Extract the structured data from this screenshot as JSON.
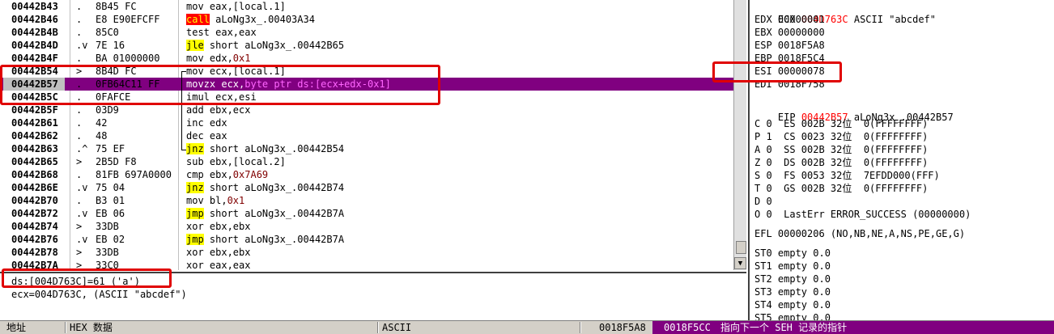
{
  "disasm": {
    "rows": [
      {
        "addr": "00442B43",
        "mark": ".",
        "hex": "8B45 FC",
        "pre": "mov eax,[local.1]",
        "kw": "",
        "post": "",
        "imm": ""
      },
      {
        "addr": "00442B46",
        "mark": ".",
        "hex": "E8 E90EFCFF",
        "pre": "",
        "kw": "call",
        "post": " aLoNg3x_.00403A34",
        "imm": ""
      },
      {
        "addr": "00442B4B",
        "mark": ".",
        "hex": "85C0",
        "pre": "test eax,eax",
        "kw": "",
        "post": "",
        "imm": ""
      },
      {
        "addr": "00442B4D",
        "mark": ".v",
        "hex": "7E 16",
        "pre": "",
        "kw": "jle",
        "post": " short aLoNg3x_.00442B65",
        "imm": ""
      },
      {
        "addr": "00442B4F",
        "mark": ".",
        "hex": "BA 01000000",
        "pre": "mov edx,",
        "kw": "",
        "post": "",
        "imm": "0x1"
      },
      {
        "addr": "00442B54",
        "mark": ">",
        "hex": "8B4D FC",
        "pre": "mov ecx,[local.1]",
        "kw": "",
        "post": "",
        "imm": ""
      },
      {
        "addr": "00442B57",
        "mark": ".",
        "hex": "0FB64C11 FF",
        "pre": "movzx ecx,",
        "kw": "",
        "post": "",
        "imm": "byte ptr ds:[ecx+edx-0x1]"
      },
      {
        "addr": "00442B5C",
        "mark": ".",
        "hex": "0FAFCE",
        "pre": "imul ecx,esi",
        "kw": "",
        "post": "",
        "imm": ""
      },
      {
        "addr": "00442B5F",
        "mark": ".",
        "hex": "03D9",
        "pre": "add ebx,ecx",
        "kw": "",
        "post": "",
        "imm": ""
      },
      {
        "addr": "00442B61",
        "mark": ".",
        "hex": "42",
        "pre": "inc edx",
        "kw": "",
        "post": "",
        "imm": ""
      },
      {
        "addr": "00442B62",
        "mark": ".",
        "hex": "48",
        "pre": "dec eax",
        "kw": "",
        "post": "",
        "imm": ""
      },
      {
        "addr": "00442B63",
        "mark": ".^",
        "hex": "75 EF",
        "pre": "",
        "kw": "jnz",
        "post": " short aLoNg3x_.00442B54",
        "imm": ""
      },
      {
        "addr": "00442B65",
        "mark": ">",
        "hex": "2B5D F8",
        "pre": "sub ebx,[local.2]",
        "kw": "",
        "post": "",
        "imm": ""
      },
      {
        "addr": "00442B68",
        "mark": ".",
        "hex": "81FB 697A0000",
        "pre": "cmp ebx,",
        "kw": "",
        "post": "",
        "imm": "0x7A69"
      },
      {
        "addr": "00442B6E",
        "mark": ".v",
        "hex": "75 04",
        "pre": "",
        "kw": "jnz",
        "post": " short aLoNg3x_.00442B74",
        "imm": ""
      },
      {
        "addr": "00442B70",
        "mark": ".",
        "hex": "B3 01",
        "pre": "mov bl,",
        "kw": "",
        "post": "",
        "imm": "0x1"
      },
      {
        "addr": "00442B72",
        "mark": ".v",
        "hex": "EB 06",
        "pre": "",
        "kw": "jmp",
        "post": " short aLoNg3x_.00442B7A",
        "imm": ""
      },
      {
        "addr": "00442B74",
        "mark": ">",
        "hex": "33DB",
        "pre": "xor ebx,ebx",
        "kw": "",
        "post": "",
        "imm": ""
      },
      {
        "addr": "00442B76",
        "mark": ".v",
        "hex": "EB 02",
        "pre": "",
        "kw": "jmp",
        "post": " short aLoNg3x_.00442B7A",
        "imm": ""
      },
      {
        "addr": "00442B78",
        "mark": ">",
        "hex": "33DB",
        "pre": "xor ebx,ebx",
        "kw": "",
        "post": "",
        "imm": ""
      },
      {
        "addr": "00442B7A",
        "mark": ">",
        "hex": "33C0",
        "pre": "xor eax,eax",
        "kw": "",
        "post": "",
        "imm": ""
      }
    ],
    "selected_index": 6
  },
  "info": {
    "line1": "ds:[004D763C]=61 ('a')",
    "line2": "ecx=004D763C, (ASCII \"abcdef\")"
  },
  "registers": {
    "ecx_name": "ECX",
    "ecx_val": "004D763C",
    "ecx_note": "ASCII \"abcdef\"",
    "lines": [
      {
        "text": "EDX 00000001"
      },
      {
        "text": "EBX 00000000"
      },
      {
        "text": "ESP 0018F5A8"
      },
      {
        "text": "EBP 0018F5C4"
      },
      {
        "text": "ESI 00000078"
      },
      {
        "text": "EDI 0018F758"
      }
    ],
    "eip_name": "EIP",
    "eip_val": "00442B57",
    "eip_note": "aLoNg3x_.00442B57",
    "flags": [
      "C 0  ES 002B 32位  0(FFFFFFFF)",
      "P 1  CS 0023 32位  0(FFFFFFFF)",
      "A 0  SS 002B 32位  0(FFFFFFFF)",
      "Z 0  DS 002B 32位  0(FFFFFFFF)",
      "S 0  FS 0053 32位  7EFDD000(FFF)",
      "T 0  GS 002B 32位  0(FFFFFFFF)",
      "D 0",
      "O 0  LastErr ERROR_SUCCESS (00000000)"
    ],
    "efl": "EFL 00000206 (NO,NB,NE,A,NS,PE,GE,G)",
    "fpu": [
      "ST0 empty 0.0",
      "ST1 empty 0.0",
      "ST2 empty 0.0",
      "ST3 empty 0.0",
      "ST4 empty 0.0",
      "ST5 empty 0.0"
    ]
  },
  "statusbar": {
    "address_col": "地址",
    "hex_col": "HEX 数据",
    "ascii_col": "ASCII",
    "stack_top": "0018F5A8",
    "stack_val": "0018F5CC",
    "stack_note": "指向下一个 SEH 记录的指针"
  },
  "colors": {
    "selection": "#800080",
    "highlight_box": "#e00000",
    "call_bg": "#ff0000",
    "jump_bg": "#ffff00"
  }
}
